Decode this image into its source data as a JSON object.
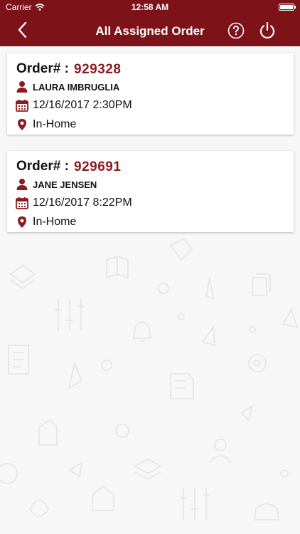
{
  "status_bar": {
    "carrier": "Carrier",
    "time": "12:58 AM"
  },
  "nav": {
    "title": "All Assigned Order"
  },
  "orders": [
    {
      "order_label": "Order# :",
      "order_number": "929328",
      "customer": "LAURA IMBRUGLIA",
      "datetime": "12/16/2017 2:30PM",
      "location": "In-Home"
    },
    {
      "order_label": "Order# :",
      "order_number": "929691",
      "customer": "JANE JENSEN",
      "datetime": "12/16/2017 8:22PM",
      "location": "In-Home"
    }
  ],
  "colors": {
    "brand": "#7d1218",
    "accent_text": "#8c1a1e"
  }
}
